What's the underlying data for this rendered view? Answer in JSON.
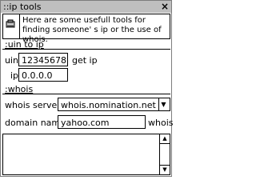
{
  "window": {
    "title": "::ip tools",
    "close_label": "×"
  },
  "info": {
    "text": "Here are some usefull tools for finding someone' s ip or the use of whois."
  },
  "uin_section": {
    "title": ":uin to ip",
    "uin_label": "uin:",
    "uin_value": "12345678",
    "get_ip_label": "get ip",
    "ip_label": "ip:",
    "ip_value": "0.0.0.0"
  },
  "whois_section": {
    "title": ":whois",
    "server_label": "whois server:",
    "server_value": "whois.nomination.net",
    "domain_label": "domain name:",
    "domain_value": "yahoo.com",
    "whois_button": "whois"
  },
  "output": {
    "value": ""
  },
  "icons": {
    "close": "close-icon",
    "info": "computer-icon",
    "dropdown": "chevron-down-icon"
  }
}
